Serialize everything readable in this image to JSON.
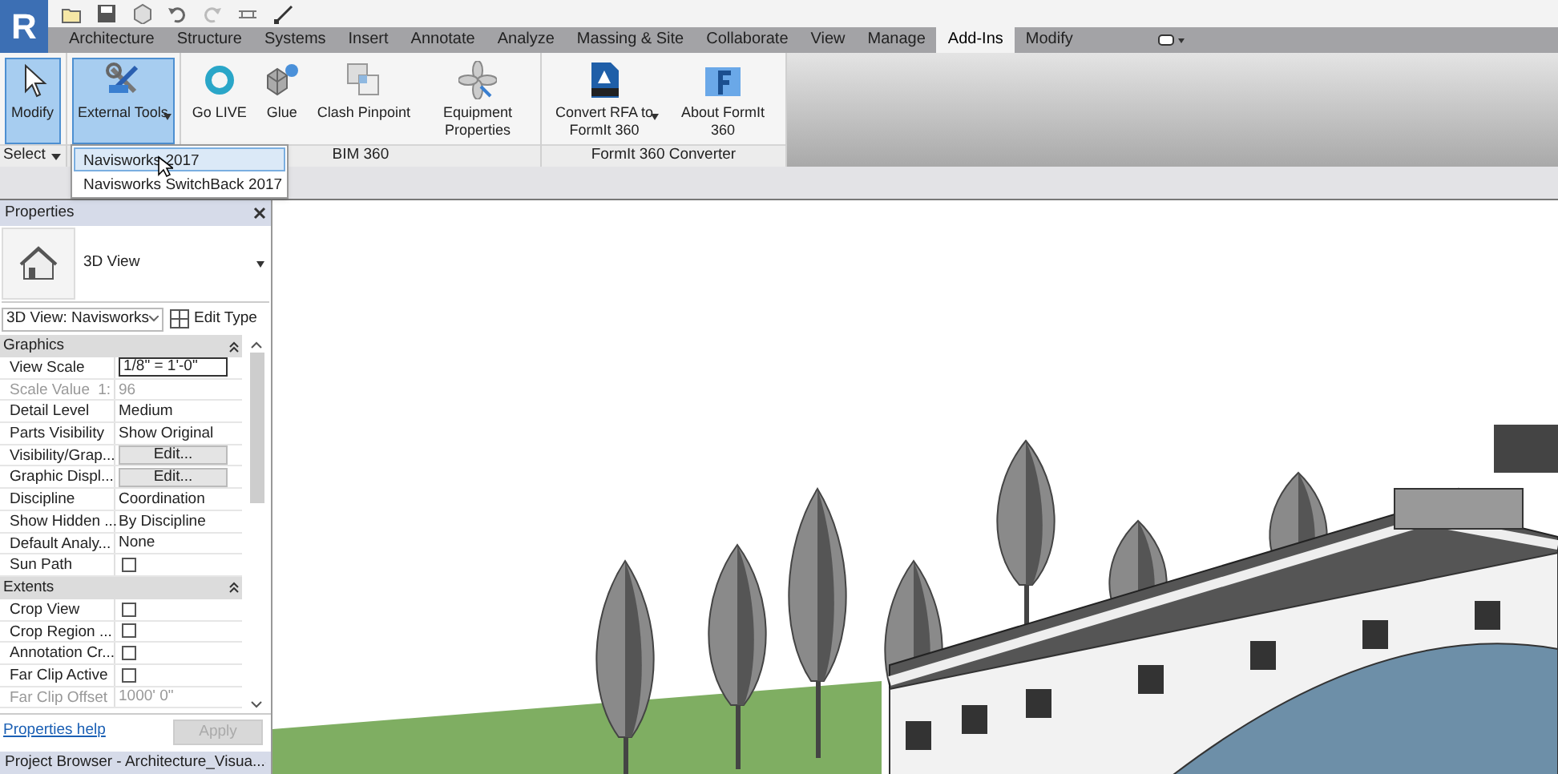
{
  "app_button": {
    "label": "R"
  },
  "ribbon_tabs": [
    {
      "label": "Architecture",
      "selected": false
    },
    {
      "label": "Structure",
      "selected": false
    },
    {
      "label": "Systems",
      "selected": false
    },
    {
      "label": "Insert",
      "selected": false
    },
    {
      "label": "Annotate",
      "selected": false
    },
    {
      "label": "Analyze",
      "selected": false
    },
    {
      "label": "Massing & Site",
      "selected": false
    },
    {
      "label": "Collaborate",
      "selected": false
    },
    {
      "label": "View",
      "selected": false
    },
    {
      "label": "Manage",
      "selected": false
    },
    {
      "label": "Add-Ins",
      "selected": true
    },
    {
      "label": "Modify",
      "selected": false
    }
  ],
  "ribbon_panels": [
    {
      "label": "Select",
      "buttons": [
        {
          "label": "Modify",
          "selected": true,
          "dropdown": false
        }
      ]
    },
    {
      "buttons": [
        {
          "label": "External Tools",
          "selected": true,
          "dropdown": true
        }
      ]
    },
    {
      "label": "BIM 360",
      "buttons": [
        {
          "label": "Go LIVE",
          "selected": false,
          "dropdown": false
        },
        {
          "label": "Glue",
          "selected": false,
          "dropdown": false
        },
        {
          "label": "Clash Pinpoint",
          "selected": false,
          "dropdown": false
        },
        {
          "label": "Equipment Properties",
          "selected": false,
          "dropdown": false
        }
      ]
    },
    {
      "label": "FormIt 360 Converter",
      "buttons": [
        {
          "label": "Convert RFA to FormIt 360",
          "selected": false,
          "dropdown": true
        },
        {
          "label": "About FormIt 360",
          "selected": false,
          "dropdown": false
        }
      ]
    }
  ],
  "dropdown_menu": [
    {
      "label": "Navisworks 2017",
      "selected": true
    },
    {
      "label": "Navisworks SwitchBack 2017",
      "selected": false
    }
  ],
  "properties": {
    "title": "Properties",
    "type_name": "3D View",
    "view_selector": "3D View: Navisworks",
    "edit_type": "Edit Type",
    "sections": [
      {
        "title": "Graphics",
        "rows": [
          {
            "kind": "field",
            "label": "View Scale",
            "value": "1/8\" = 1'-0\"",
            "disabled": false
          },
          {
            "kind": "text",
            "label": "Scale Value",
            "prefix": "1:",
            "value": "96",
            "disabled": true
          },
          {
            "kind": "text",
            "label": "Detail Level",
            "value": "Medium",
            "disabled": false
          },
          {
            "kind": "text",
            "label": "Parts Visibility",
            "value": "Show Original",
            "disabled": false
          },
          {
            "kind": "button",
            "label": "Visibility/Grap...",
            "value": "Edit...",
            "disabled": false
          },
          {
            "kind": "button",
            "label": "Graphic Displ...",
            "value": "Edit...",
            "disabled": false
          },
          {
            "kind": "text",
            "label": "Discipline",
            "value": "Coordination",
            "disabled": false
          },
          {
            "kind": "text",
            "label": "Show Hidden ...",
            "value": "By Discipline",
            "disabled": false
          },
          {
            "kind": "text",
            "label": "Default Analy...",
            "value": "None",
            "disabled": false
          },
          {
            "kind": "checkbox",
            "label": "Sun Path",
            "checked": false,
            "disabled": false
          }
        ]
      },
      {
        "title": "Extents",
        "rows": [
          {
            "kind": "checkbox",
            "label": "Crop View",
            "checked": false,
            "disabled": false
          },
          {
            "kind": "checkbox",
            "label": "Crop Region ...",
            "checked": false,
            "disabled": false
          },
          {
            "kind": "checkbox",
            "label": "Annotation Cr...",
            "checked": false,
            "disabled": false
          },
          {
            "kind": "checkbox",
            "label": "Far Clip Active",
            "checked": false,
            "disabled": false
          },
          {
            "kind": "text",
            "label": "Far Clip Offset",
            "value": "1000'  0\"",
            "disabled": true
          }
        ]
      }
    ],
    "help_link": "Properties help",
    "apply_button": {
      "label": "Apply",
      "disabled": true
    }
  },
  "project_browser": {
    "title": "Project Browser - Architecture_Visua..."
  }
}
